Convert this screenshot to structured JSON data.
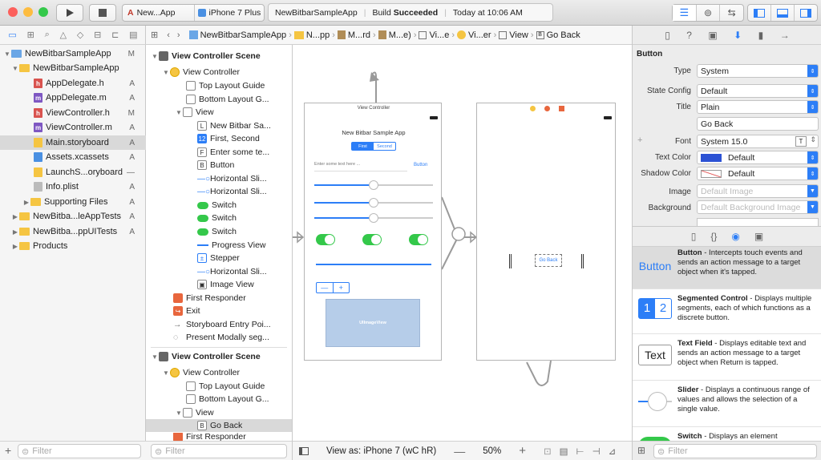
{
  "toolbar": {
    "scheme": "New...App",
    "device": "iPhone 7 Plus",
    "status_app": "NewBitbarSampleApp",
    "status_build": "Build",
    "status_result": "Succeeded",
    "status_time": "Today at 10:06 AM"
  },
  "navigator": {
    "items": [
      {
        "label": "NewBitbarSampleApp",
        "status": "M"
      },
      {
        "label": "NewBitbarSampleApp",
        "status": ""
      },
      {
        "label": "AppDelegate.h",
        "status": "A",
        "icon": "h"
      },
      {
        "label": "AppDelegate.m",
        "status": "A",
        "icon": "m"
      },
      {
        "label": "ViewController.h",
        "status": "M",
        "icon": "h"
      },
      {
        "label": "ViewController.m",
        "status": "A",
        "icon": "m"
      },
      {
        "label": "Main.storyboard",
        "status": "A"
      },
      {
        "label": "Assets.xcassets",
        "status": "A"
      },
      {
        "label": "LaunchS...oryboard",
        "status": "—"
      },
      {
        "label": "Info.plist",
        "status": "A"
      },
      {
        "label": "Supporting Files",
        "status": "A"
      },
      {
        "label": "NewBitba...leAppTests",
        "status": "A"
      },
      {
        "label": "NewBitba...ppUITests",
        "status": "A"
      },
      {
        "label": "Products",
        "status": ""
      }
    ],
    "filter_placeholder": "Filter"
  },
  "jumpbar": {
    "items": [
      "NewBitbarSampleApp",
      "N...pp",
      "M...rd",
      "M...e)",
      "Vi...e",
      "Vi...er",
      "View",
      "Go Back"
    ]
  },
  "outline": {
    "items": [
      {
        "label": "View Controller Scene",
        "bold": true
      },
      {
        "label": "View Controller"
      },
      {
        "label": "Top Layout Guide"
      },
      {
        "label": "Bottom Layout G..."
      },
      {
        "label": "View"
      },
      {
        "label": "New Bitbar Sa..."
      },
      {
        "label": "First, Second"
      },
      {
        "label": "Enter some te..."
      },
      {
        "label": "Button"
      },
      {
        "label": "Horizontal Sli..."
      },
      {
        "label": "Horizontal Sli..."
      },
      {
        "label": "Switch"
      },
      {
        "label": "Switch"
      },
      {
        "label": "Switch"
      },
      {
        "label": "Progress View"
      },
      {
        "label": "Stepper"
      },
      {
        "label": "Horizontal Sli..."
      },
      {
        "label": "Image View"
      },
      {
        "label": "First Responder"
      },
      {
        "label": "Exit"
      },
      {
        "label": "Storyboard Entry Poi..."
      },
      {
        "label": "Present Modally seg..."
      },
      {
        "label": "View Controller Scene",
        "bold": true
      },
      {
        "label": "View Controller"
      },
      {
        "label": "Top Layout Guide"
      },
      {
        "label": "Bottom Layout G..."
      },
      {
        "label": "View"
      },
      {
        "label": "Go Back"
      },
      {
        "label": "First Responder"
      }
    ],
    "filter_placeholder": "Filter"
  },
  "canvas": {
    "scene1_title": "View Controller",
    "app_title": "New Bitbar Sample App",
    "segment_first": "First",
    "segment_second": "Second",
    "textfield_placeholder": "Enter some text here ...",
    "button_label": "Button",
    "image_label": "UIImageView",
    "goback_label": "Go Back",
    "view_as": "View as: iPhone 7 (wC hR)",
    "zoom": "50%",
    "zoom_minus": "—",
    "zoom_plus": "+"
  },
  "inspector": {
    "section": "Button",
    "rows": {
      "type_label": "Type",
      "type_value": "System",
      "state_label": "State Config",
      "state_value": "Default",
      "title_label": "Title",
      "title_value": "Plain",
      "title_text": "Go Back",
      "font_label": "Font",
      "font_value": "System 15.0",
      "textcolor_label": "Text Color",
      "textcolor_value": "Default",
      "shadow_label": "Shadow Color",
      "shadow_value": "Default",
      "image_label": "Image",
      "image_placeholder": "Default Image",
      "bg_label": "Background",
      "bg_placeholder": "Default Background Image"
    },
    "library": [
      {
        "title": "Button",
        "desc": " - Intercepts touch events and sends an action message to a target object when it's tapped.",
        "icon_text": "Button"
      },
      {
        "title": "Segmented Control",
        "desc": " - Displays multiple segments, each of which functions as a discrete button.",
        "icon_text": "1 2"
      },
      {
        "title": "Text Field",
        "desc": " - Displays editable text and sends an action message to a target object when Return is tapped.",
        "icon_text": "Text"
      },
      {
        "title": "Slider",
        "desc": " - Displays a continuous range of values and allows the selection of a single value.",
        "icon_text": ""
      },
      {
        "title": "Switch",
        "desc": " - Displays an element",
        "icon_text": ""
      }
    ],
    "filter_placeholder": "Filter"
  },
  "colors": {
    "accent": "#2c7ef7",
    "selection": "#d9d9d9"
  }
}
